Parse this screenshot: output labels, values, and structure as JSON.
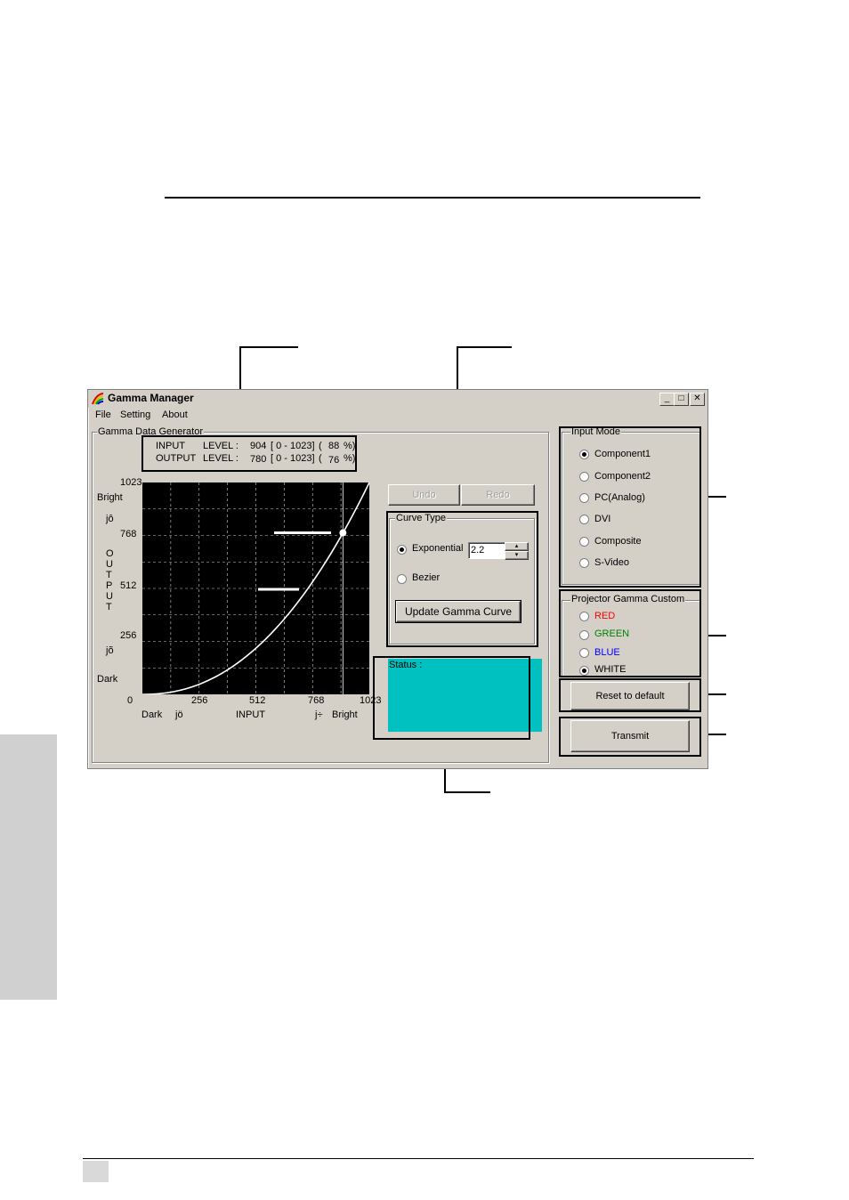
{
  "window": {
    "title": "Gamma Manager",
    "controls": {
      "minimize": "_",
      "maximize": "□",
      "close": "✕"
    }
  },
  "menu": [
    "File",
    "Setting",
    "About"
  ],
  "generator": {
    "group_title": "Gamma Data Generator",
    "input_label": "INPUT",
    "output_label": "OUTPUT",
    "level_label": "LEVEL :",
    "input_value": "904",
    "output_value": "780",
    "range": "[ 0 - 1023]",
    "paren_open": "(",
    "input_percent": "88",
    "output_percent": "76",
    "percent_close": "%)"
  },
  "graph": {
    "y_axis": {
      "top_value": "1023",
      "bright": "Bright",
      "arrow_up": "jô",
      "v768": "768",
      "vertical_label": [
        "O",
        "U",
        "T",
        "P",
        "U",
        "T"
      ],
      "v512": "512",
      "v256": "256",
      "arrow_down": "jõ",
      "dark": "Dark",
      "zero": "0"
    },
    "x_axis": {
      "dark": "Dark",
      "arrow_left": "jö",
      "v256": "256",
      "v512": "512",
      "input": "INPUT",
      "v768": "768",
      "v1023": "1023",
      "arrow_right": "j÷",
      "bright": "Bright"
    },
    "marker": {
      "input": 904,
      "output": 780
    },
    "gamma": 2.2,
    "max": 1023,
    "curve_color": "#ffffff",
    "background": "#000000"
  },
  "buttons": {
    "undo": "Undo",
    "redo": "Redo",
    "update": "Update Gamma Curve",
    "reset": "Reset to default",
    "transmit": "Transmit"
  },
  "curve_type": {
    "title": "Curve Type",
    "exponential": "Exponential",
    "exponent_value": "2.2",
    "bezier": "Bezier",
    "selected": "Exponential"
  },
  "status": {
    "label": "Status :",
    "color": "#00c0c0"
  },
  "input_mode": {
    "title": "Input Mode",
    "options": [
      "Component1",
      "Component2",
      "PC(Analog)",
      "DVI",
      "Composite",
      "S-Video"
    ],
    "selected": "Component1"
  },
  "gamma_custom": {
    "title": "Projector Gamma Custom",
    "options": [
      {
        "label": "RED",
        "color": "#ff0000"
      },
      {
        "label": "GREEN",
        "color": "#008000"
      },
      {
        "label": "BLUE",
        "color": "#0000ff"
      },
      {
        "label": "WHITE",
        "color": "#000000"
      }
    ],
    "selected": "WHITE"
  }
}
